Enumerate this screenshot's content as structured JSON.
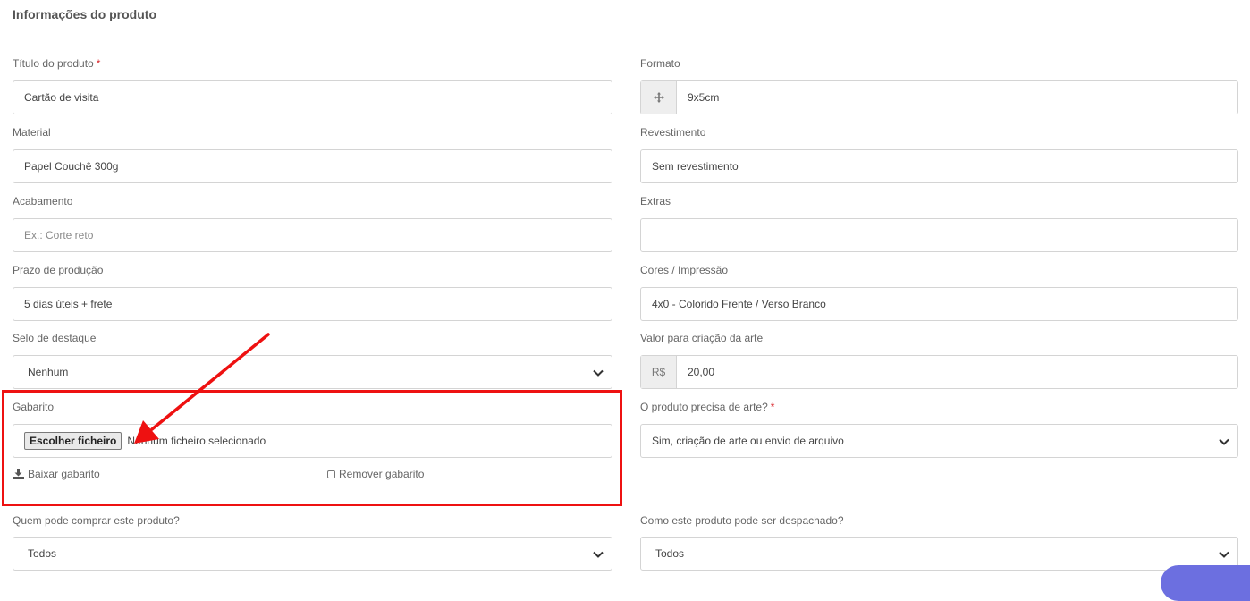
{
  "section_title": "Informações do produto",
  "fields": {
    "titulo": {
      "label": "Título do produto",
      "required_mark": "*",
      "value": "Cartão de visita"
    },
    "formato": {
      "label": "Formato",
      "value": "9x5cm",
      "icon": "move-icon"
    },
    "material": {
      "label": "Material",
      "value": "Papel Couchê 300g"
    },
    "revestimento": {
      "label": "Revestimento",
      "value": "Sem revestimento"
    },
    "acabamento": {
      "label": "Acabamento",
      "value": "",
      "placeholder": "Ex.: Corte reto"
    },
    "extras": {
      "label": "Extras",
      "value": ""
    },
    "prazo": {
      "label": "Prazo de produção",
      "value": "5 dias úteis + frete"
    },
    "cores": {
      "label": "Cores / Impressão",
      "value": "4x0 - Colorido Frente / Verso Branco"
    },
    "selo": {
      "label": "Selo de destaque",
      "selected": "Nenhum"
    },
    "valor_arte": {
      "label": "Valor para criação da arte",
      "prefix": "R$",
      "value": "20,00"
    },
    "gabarito": {
      "label": "Gabarito",
      "button_label": "Escolher ficheiro",
      "status": "Nenhum ficheiro selecionado",
      "download_label": "Baixar gabarito",
      "download_icon": "download-icon",
      "remove_label": "Remover gabarito",
      "remove_checked": false
    },
    "precisa_arte": {
      "label": "O produto precisa de arte?",
      "required_mark": "*",
      "selected": "Sim, criação de arte ou envio de arquivo"
    },
    "quem_compra": {
      "label": "Quem pode comprar este produto?",
      "selected": "Todos"
    },
    "despacho": {
      "label": "Como este produto pode ser despachado?",
      "selected": "Todos"
    }
  },
  "colors": {
    "highlight": "#ee1111",
    "required": "#d9262c",
    "border": "#d4d4d4",
    "fab": "#6c6fe0"
  }
}
